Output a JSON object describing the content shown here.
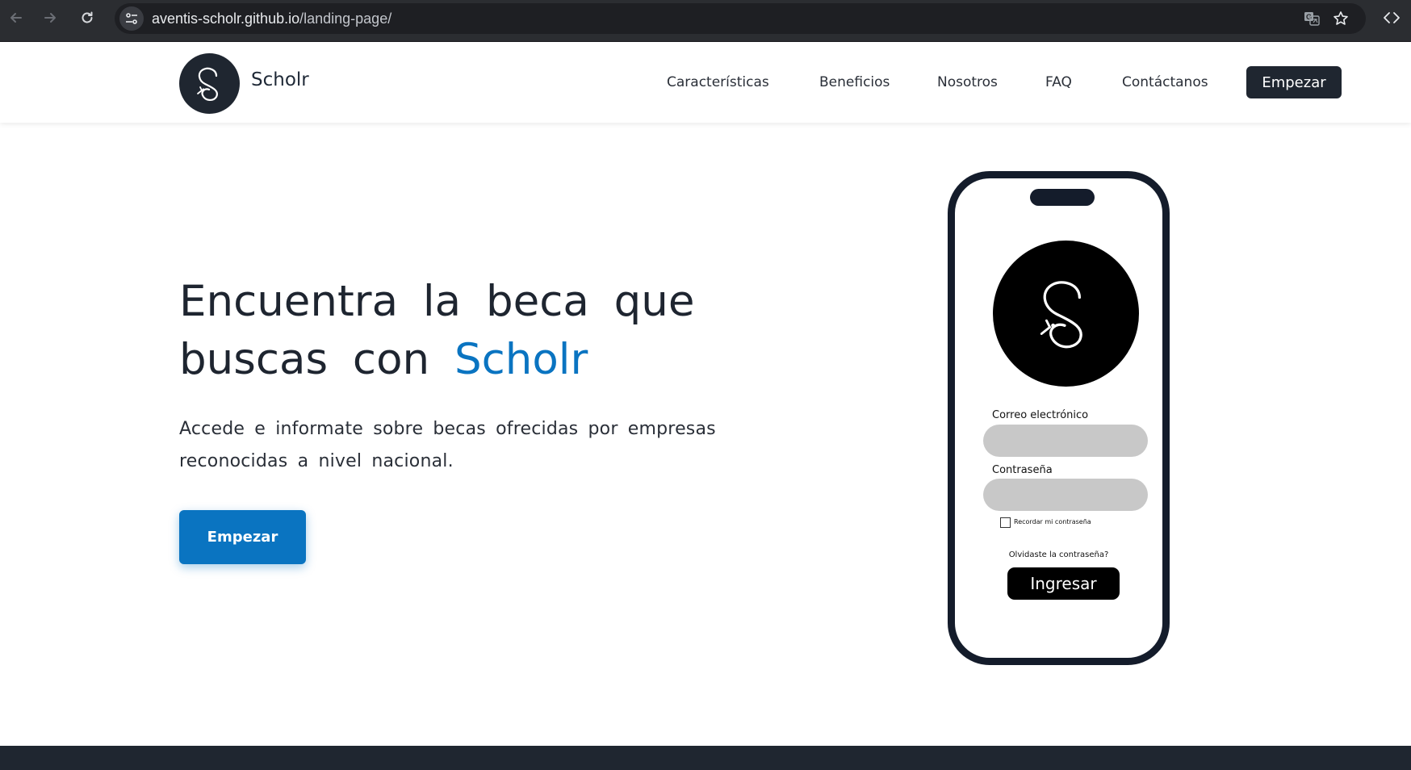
{
  "browser": {
    "url_host": "aventis-scholr.github.io",
    "url_path": "/landing-page/",
    "icons": [
      "back-arrow-icon",
      "forward-arrow-icon",
      "reload-icon",
      "site-info-icon",
      "translate-icon",
      "bookmark-star-icon",
      "devtools-code-icon"
    ]
  },
  "header": {
    "brand": "Scholr",
    "nav": [
      "Características",
      "Beneficios",
      "Nosotros",
      "FAQ",
      "Contáctanos"
    ],
    "cta": "Empezar"
  },
  "hero": {
    "title_part1": "Encuentra la beca que buscas con",
    "title_accent": "Scholr",
    "subtitle": "Accede e informate sobre becas ofrecidas por empresas reconocidas a nivel nacional.",
    "cta": "Empezar"
  },
  "phone": {
    "email_label": "Correo electrónico",
    "password_label": "Contraseña",
    "remember_label": "Recordar mi contraseña",
    "forgot": "Olvidaste la contraseña?",
    "submit": "Ingresar"
  },
  "colors": {
    "accent": "#0a74c1",
    "dark": "#1f2630",
    "chrome": "#2b2d31"
  }
}
